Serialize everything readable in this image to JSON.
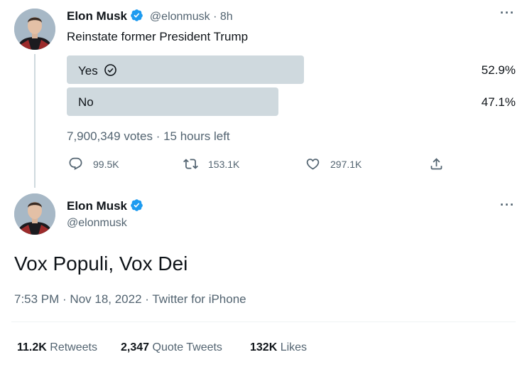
{
  "colors": {
    "text": "#0f1419",
    "secondary": "#536471",
    "verified": "#1d9bf0",
    "poll_bar": "#cfd9de"
  },
  "poll_tweet": {
    "author_name": "Elon Musk",
    "handle": "@elonmusk",
    "time": "8h",
    "text": "Reinstate former President Trump",
    "poll": {
      "options": [
        {
          "label": "Yes",
          "percent_text": "52.9%",
          "percent": 52.9,
          "winner": true
        },
        {
          "label": "No",
          "percent_text": "47.1%",
          "percent": 47.1,
          "winner": false
        }
      ],
      "summary": "7,900,349 votes · 15 hours left"
    },
    "actions": {
      "replies": "99.5K",
      "retweets": "153.1K",
      "likes": "297.1K"
    },
    "icons": [
      "verified-badge-icon",
      "more-icon",
      "check-circle-icon",
      "reply-icon",
      "retweet-icon",
      "like-icon",
      "share-icon"
    ]
  },
  "main_tweet": {
    "author_name": "Elon Musk",
    "handle": "@elonmusk",
    "text": "Vox Populi, Vox Dei",
    "date_line": "7:53 PM · Nov 18, 2022 · Twitter for iPhone",
    "stats": {
      "retweets_count": "11.2K",
      "retweets_label": "Retweets",
      "quotes_count": "2,347",
      "quotes_label": "Quote Tweets",
      "likes_count": "132K",
      "likes_label": "Likes"
    }
  }
}
